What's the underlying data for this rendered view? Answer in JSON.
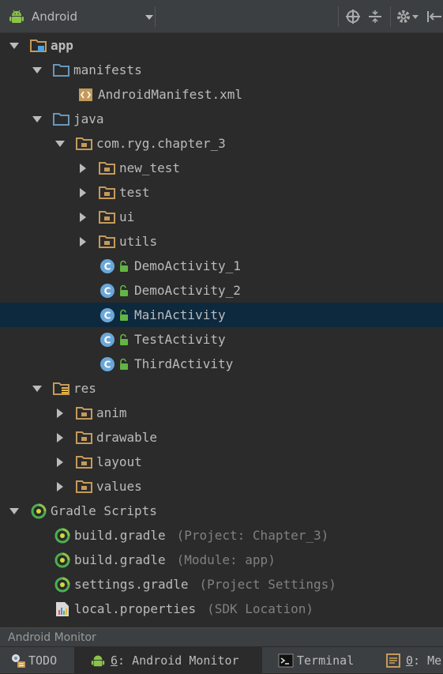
{
  "toolbar": {
    "view_label": "Android",
    "icons": [
      "android-icon",
      "dropdown-arrow-icon",
      "target-icon",
      "collapse-icon",
      "gear-icon",
      "hide-icon"
    ]
  },
  "tree": [
    {
      "label": "app",
      "hint": "",
      "expanded": true,
      "icon": "module-folder"
    },
    {
      "label": "manifests",
      "hint": "",
      "expanded": true,
      "icon": "folder-blue"
    },
    {
      "label": "AndroidManifest.xml",
      "hint": "",
      "icon": "xml-file"
    },
    {
      "label": "java",
      "hint": "",
      "expanded": true,
      "icon": "folder-blue"
    },
    {
      "label": "com.ryg.chapter_3",
      "hint": "",
      "expanded": true,
      "icon": "package-folder"
    },
    {
      "label": "new_test",
      "hint": "",
      "expanded": false,
      "icon": "package-folder"
    },
    {
      "label": "test",
      "hint": "",
      "expanded": false,
      "icon": "package-folder"
    },
    {
      "label": "ui",
      "hint": "",
      "expanded": false,
      "icon": "package-folder"
    },
    {
      "label": "utils",
      "hint": "",
      "expanded": false,
      "icon": "package-folder"
    },
    {
      "label": "DemoActivity_1",
      "hint": "",
      "icon": "java-class"
    },
    {
      "label": "DemoActivity_2",
      "hint": "",
      "icon": "java-class"
    },
    {
      "label": "MainActivity",
      "hint": "",
      "icon": "java-class",
      "selected": true
    },
    {
      "label": "TestActivity",
      "hint": "",
      "icon": "java-class"
    },
    {
      "label": "ThirdActivity",
      "hint": "",
      "icon": "java-class"
    },
    {
      "label": "res",
      "hint": "",
      "expanded": true,
      "icon": "res-folder"
    },
    {
      "label": "anim",
      "hint": "",
      "expanded": false,
      "icon": "package-folder"
    },
    {
      "label": "drawable",
      "hint": "",
      "expanded": false,
      "icon": "package-folder"
    },
    {
      "label": "layout",
      "hint": "",
      "expanded": false,
      "icon": "package-folder"
    },
    {
      "label": "values",
      "hint": "",
      "expanded": false,
      "icon": "package-folder"
    },
    {
      "label": "Gradle Scripts",
      "hint": "",
      "expanded": true,
      "icon": "gradle"
    },
    {
      "label": "build.gradle",
      "hint": "(Project: Chapter_3)",
      "icon": "gradle"
    },
    {
      "label": "build.gradle",
      "hint": "(Module: app)",
      "icon": "gradle"
    },
    {
      "label": "settings.gradle",
      "hint": "(Project Settings)",
      "icon": "gradle"
    },
    {
      "label": "local.properties",
      "hint": "(SDK Location)",
      "icon": "properties-file"
    }
  ],
  "monitor_strip": {
    "label": "Android Monitor"
  },
  "statusbar": {
    "todo": "TODO",
    "monitor_num": "6",
    "monitor_rest": ": Android Monitor",
    "terminal": "Terminal",
    "messages_num": "0",
    "messages_rest": ": Me"
  },
  "colors": {
    "background": "#2b2b2b",
    "panel": "#3c3f41",
    "selection": "#0d293e",
    "text": "#bbbbbb",
    "hint": "#808080"
  }
}
